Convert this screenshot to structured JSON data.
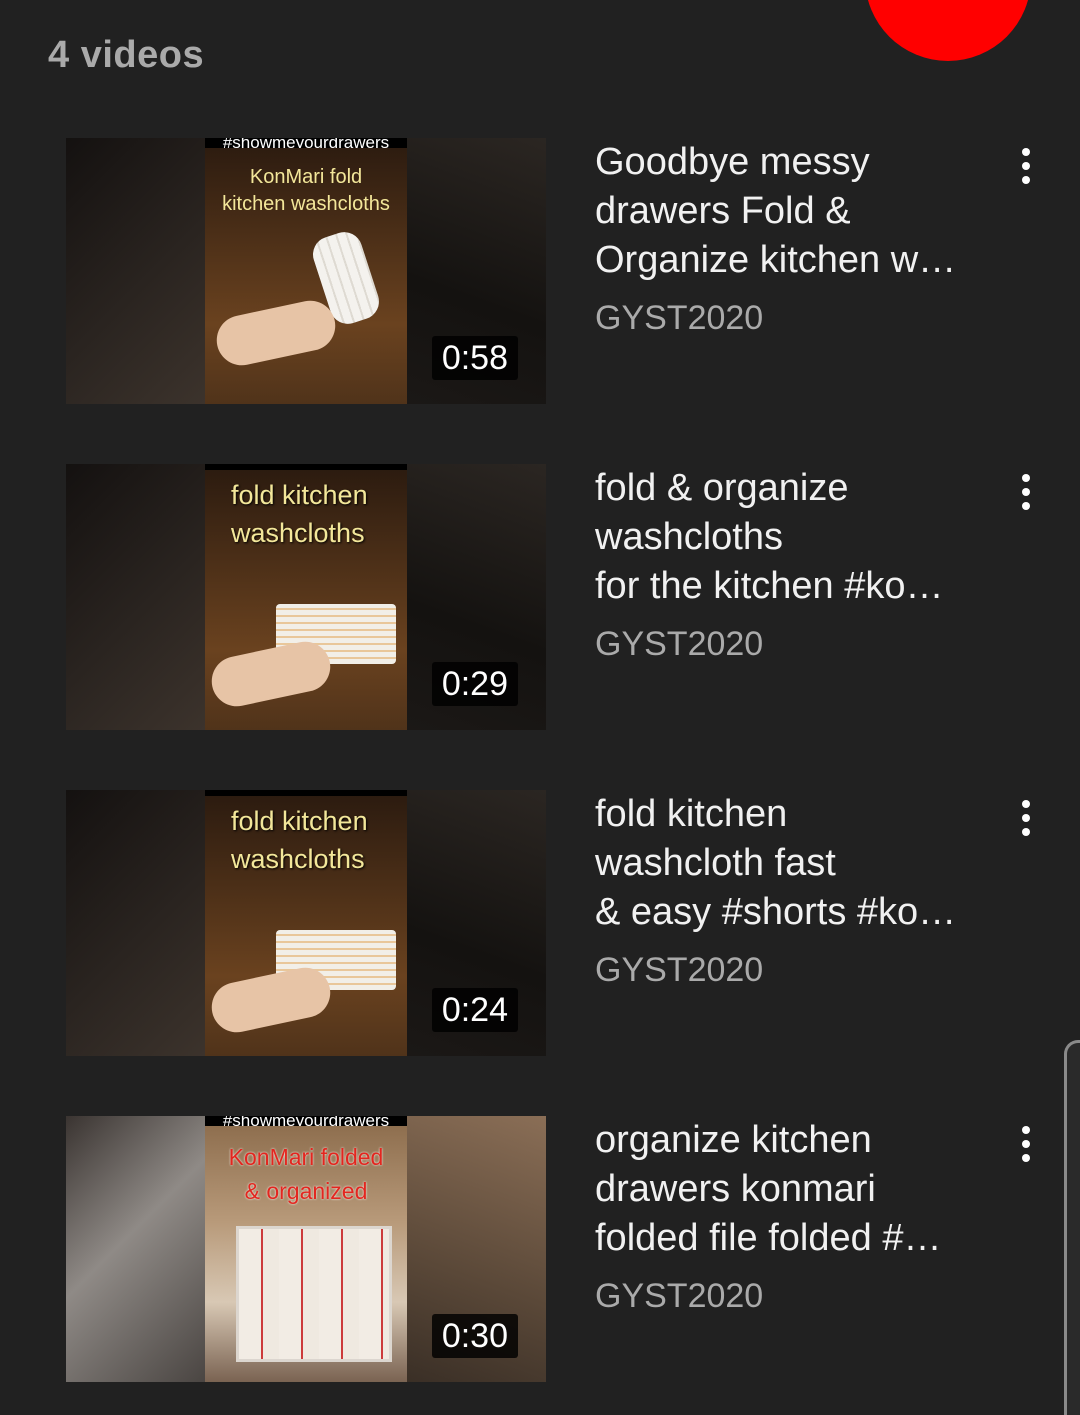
{
  "header": {
    "video_count": "4 videos"
  },
  "videos": [
    {
      "title": "Goodbye messy\ndrawers Fold &\nOrganize kitchen w…",
      "channel": "GYST2020",
      "duration": "0:58",
      "thumbnail_hashtag": "#showmeyourdrawers",
      "thumbnail_caption": "KonMari fold\nkitchen washcloths"
    },
    {
      "title": "fold & organize\nwashcloths\nfor the kitchen #ko…",
      "channel": "GYST2020",
      "duration": "0:29",
      "thumbnail_caption": "fold kitchen\nwashcloths"
    },
    {
      "title": "fold kitchen\nwashcloth fast\n& easy #shorts #ko…",
      "channel": "GYST2020",
      "duration": "0:24",
      "thumbnail_caption": "fold kitchen\nwashcloths"
    },
    {
      "title": "organize kitchen\ndrawers konmari\nfolded file folded #…",
      "channel": "GYST2020",
      "duration": "0:30",
      "thumbnail_hashtag": "#showmeyourdrawers",
      "thumbnail_caption": "KonMari folded\n& organized"
    }
  ],
  "colors": {
    "background": "#212121",
    "title_text": "#f1f1f1",
    "secondary_text": "#aaaaaa",
    "accent_red": "#ff0000",
    "caption_yellow": "#f3e79a"
  },
  "icons": {
    "more_options": "more-vert-icon"
  }
}
